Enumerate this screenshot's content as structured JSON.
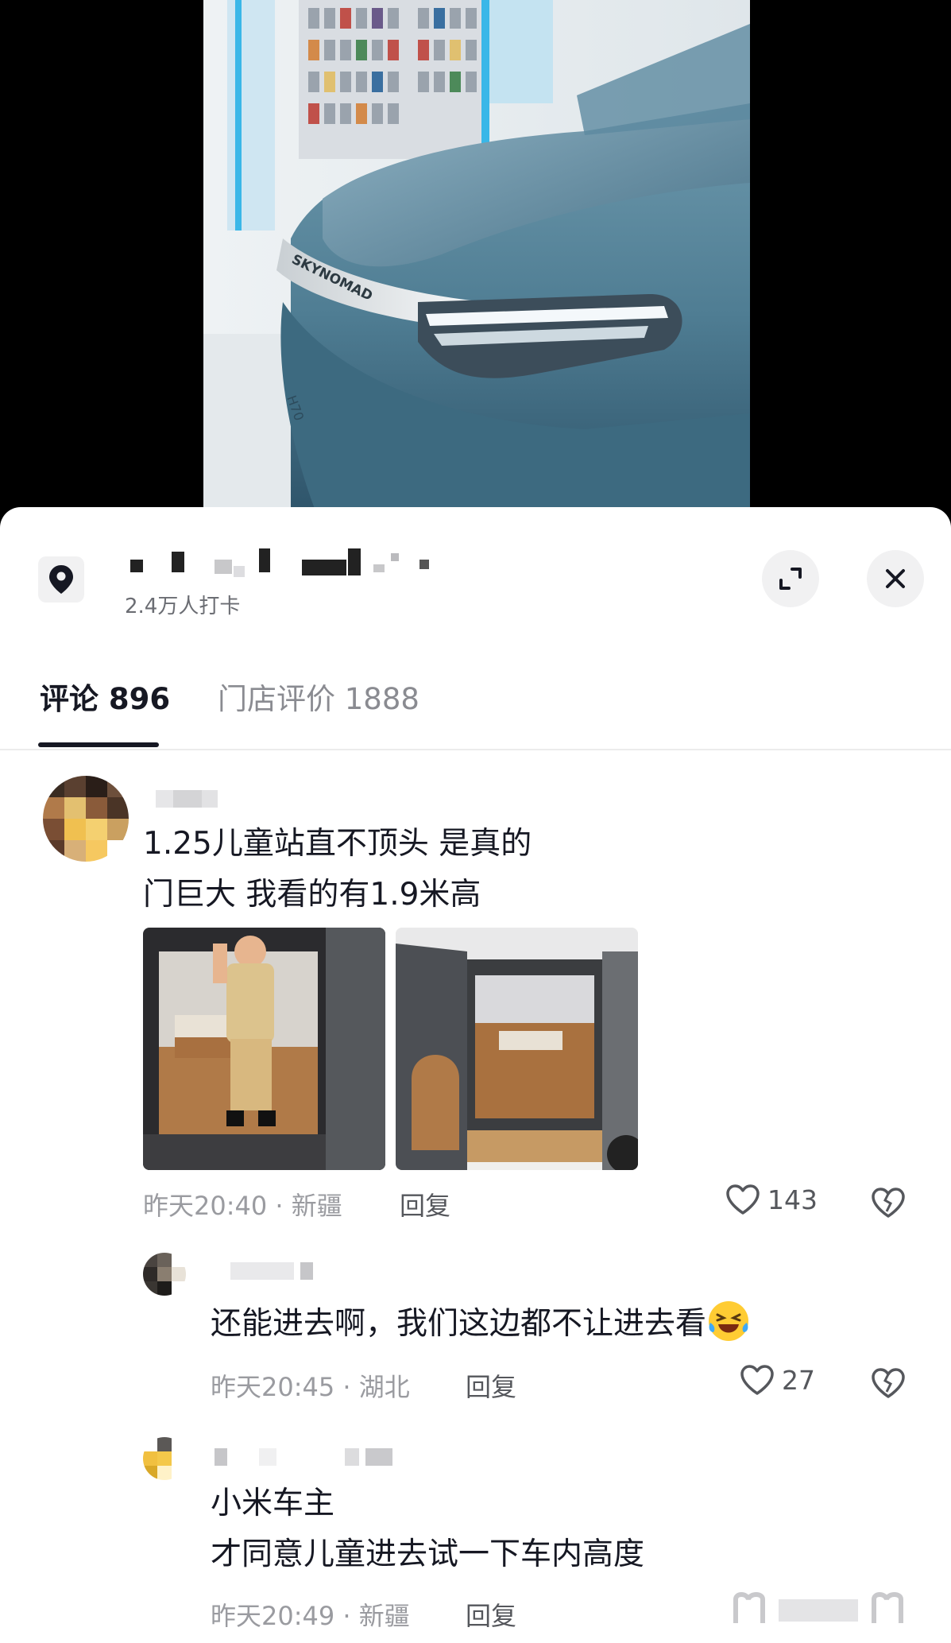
{
  "video": {
    "car_badge": "SKYNOMAD",
    "car_model_badge": "H70"
  },
  "poi": {
    "checkins": "2.4万人打卡",
    "icons": {
      "location": "location-pin-icon",
      "expand": "expand-icon",
      "close": "close-icon"
    }
  },
  "tabs": [
    {
      "label": "评论 896",
      "active": true
    },
    {
      "label": "门店评价 1888",
      "active": false
    }
  ],
  "comments": [
    {
      "line1": "1.25儿童站直不顶头 是真的",
      "line2": "门巨大  我看的有1.9米高",
      "time_location": "昨天20:40 · 新疆",
      "reply": "回复",
      "likes": "143",
      "image_count": 2
    }
  ],
  "replies": [
    {
      "username_fragment": "betr",
      "text": "还能进去啊，我们这边都不让进去看",
      "emoji": "laughing-crying-emoji",
      "time_location": "昨天20:45 · 湖北",
      "reply": "回复",
      "likes": "27"
    },
    {
      "line1": "小米车主",
      "line2": "才同意儿童进去试一下车内高度",
      "time_location": "昨天20:49 · 新疆",
      "reply": "回复"
    }
  ],
  "colors": {
    "accent_text": "#161823",
    "meta_text": "#9a9ba0",
    "sheet_bg": "#ffffff",
    "car_body": "#4f7d93"
  }
}
